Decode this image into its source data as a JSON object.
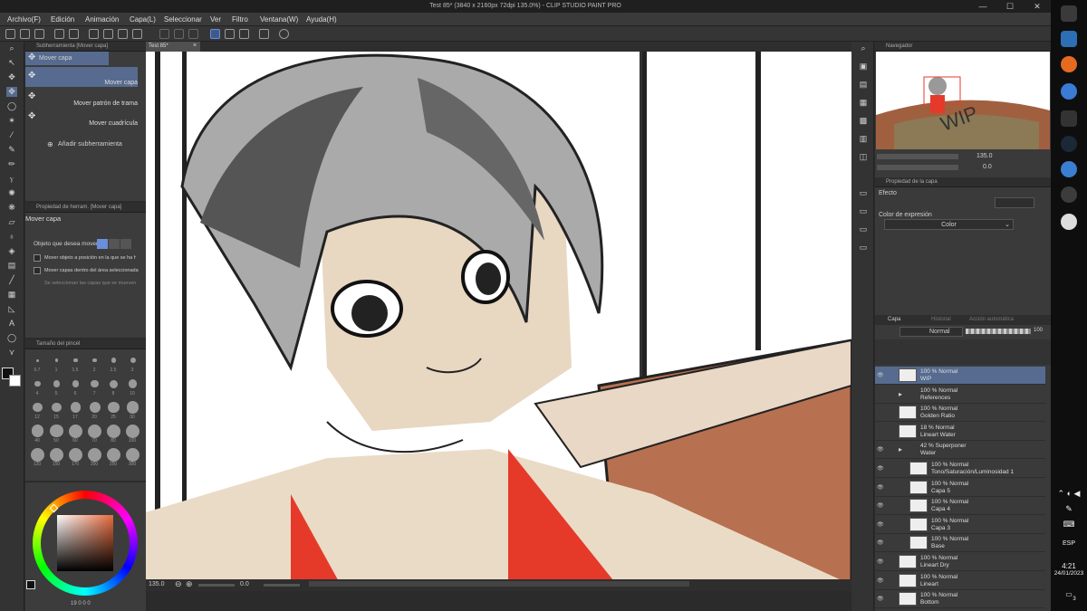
{
  "window": {
    "title": "Test 85* (3840 x 2160px 72dpi 135.0%) - CLIP STUDIO PAINT PRO",
    "min": "—",
    "max": "☐",
    "close": "✕"
  },
  "menu": [
    "Archivo(F)",
    "Edición",
    "Animación",
    "Capa(L)",
    "Seleccionar",
    "Ver",
    "Filtro",
    "Ventana(W)",
    "Ayuda(H)"
  ],
  "subtool": {
    "header": "Subherramienta [Mover capa]",
    "tab": "Mover capa",
    "items": [
      "Mover capa",
      "Mover patrón de trama",
      "Mover cuadrícula"
    ],
    "add": "Añadir subherramienta"
  },
  "tool_property": {
    "header": "Propiedad de herram. [Mover capa]",
    "title": "Mover capa",
    "target_label": "Objeto que desea mover",
    "options": [
      "Mover objeto a posición en la que se ha hecho",
      "Mover capas dentro del área seleccionada",
      "Se seleccionan las capas que se mueven"
    ]
  },
  "brush_size": {
    "header": "Tamaño del pincel",
    "sizes": [
      "0.7",
      "1",
      "1.5",
      "2",
      "2.5",
      "3",
      "4",
      "5",
      "6",
      "7",
      "8",
      "10",
      "12",
      "15",
      "17",
      "20",
      "25",
      "30",
      "40",
      "50",
      "60",
      "70",
      "80",
      "100",
      "120",
      "150",
      "170",
      "200",
      "250",
      "300"
    ]
  },
  "color_wheel": {
    "footer": "19   0   0   0",
    "foreground": "#111111",
    "background": "#ffffff",
    "accent": "#e86a3c"
  },
  "canvas": {
    "tab": "Test 85*",
    "zoom": "135.0",
    "angle": "0.0"
  },
  "navigator": {
    "header": "Navegador",
    "zoom": "135.0",
    "angle": "0.0"
  },
  "layer_property": {
    "header": "Propiedad de la capa",
    "effect": "Efecto",
    "expression_label": "Color de expresión",
    "expression_value": "Color"
  },
  "layers": {
    "tabs": [
      "Capa",
      "Historial",
      "Acción automática"
    ],
    "blend": "Normal",
    "opacity": "100",
    "rows": [
      {
        "line1": "100 % Normal",
        "line2": "WIP",
        "indent": 0,
        "folder": false,
        "selected": true,
        "visible": true
      },
      {
        "line1": "100 % Normal",
        "line2": "References",
        "indent": 0,
        "folder": true,
        "selected": false,
        "visible": false
      },
      {
        "line1": "100 % Normal",
        "line2": "Golden Ratio",
        "indent": 0,
        "folder": false,
        "selected": false,
        "visible": false
      },
      {
        "line1": "18 % Normal",
        "line2": "Lineart Water",
        "indent": 0,
        "folder": false,
        "selected": false,
        "visible": false
      },
      {
        "line1": "42 % Superponer",
        "line2": "Water",
        "indent": 0,
        "folder": true,
        "selected": false,
        "visible": true
      },
      {
        "line1": "100 % Normal",
        "line2": "Tono/Saturación/Luminosidad 1",
        "indent": 1,
        "folder": false,
        "selected": false,
        "visible": true
      },
      {
        "line1": "100 % Normal",
        "line2": "Capa 5",
        "indent": 1,
        "folder": false,
        "selected": false,
        "visible": true
      },
      {
        "line1": "100 % Normal",
        "line2": "Capa 4",
        "indent": 1,
        "folder": false,
        "selected": false,
        "visible": true
      },
      {
        "line1": "100 % Normal",
        "line2": "Capa 3",
        "indent": 1,
        "folder": false,
        "selected": false,
        "visible": true
      },
      {
        "line1": "100 % Normal",
        "line2": "Base",
        "indent": 1,
        "folder": false,
        "selected": false,
        "visible": true
      },
      {
        "line1": "100 % Normal",
        "line2": "Lineart Dry",
        "indent": 0,
        "folder": false,
        "selected": false,
        "visible": true
      },
      {
        "line1": "100 % Normal",
        "line2": "Lineart",
        "indent": 0,
        "folder": false,
        "selected": false,
        "visible": true
      },
      {
        "line1": "100 % Normal",
        "line2": "Bottom",
        "indent": 0,
        "folder": false,
        "selected": false,
        "visible": true
      }
    ]
  },
  "taskbar": {
    "lang": "ESP",
    "time": "4:21",
    "date": "24/01/2023",
    "notif": "3"
  }
}
